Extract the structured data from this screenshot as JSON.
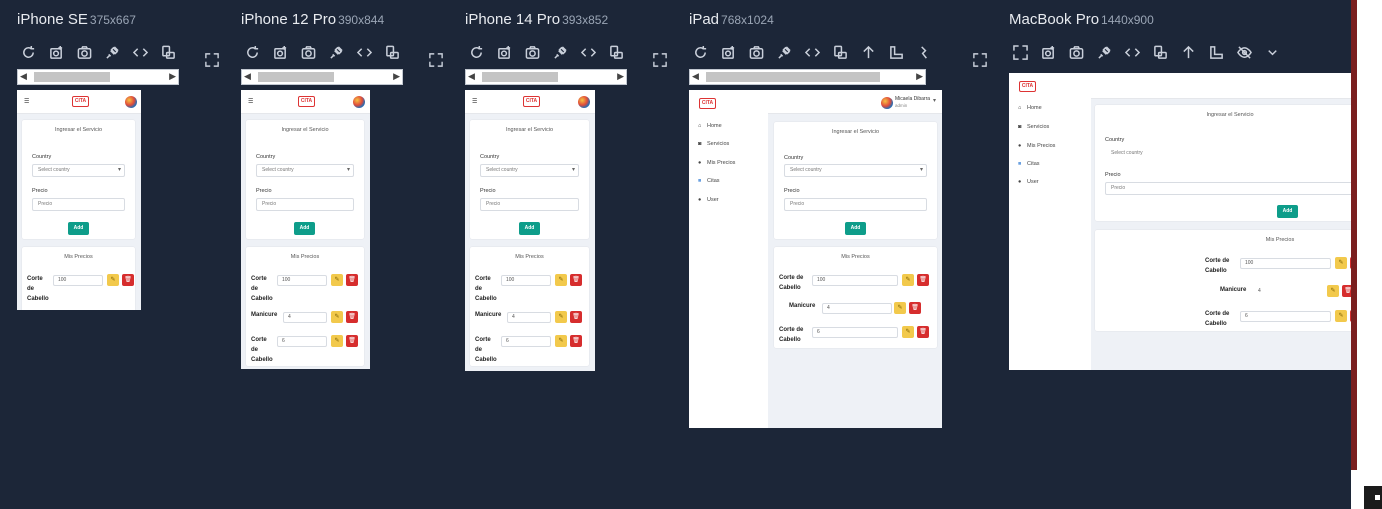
{
  "colors": {
    "background": "#1c2638",
    "accent": "#0e9d8a",
    "edit": "#f2c94c",
    "delete": "#d62d2d",
    "logo": "#d33333"
  },
  "toolbar_icons": [
    "refresh-icon",
    "screenshot-icon",
    "camera-icon",
    "plug-icon",
    "code-icon",
    "rotate-device-icon",
    "arrow-up-icon",
    "ruler-icon",
    "eye-off-icon",
    "chevron-down-icon"
  ],
  "app": {
    "logo": "CITA",
    "form_title": "Ingresar el Servicio",
    "country_label": "Country",
    "country_placeholder": "Select country",
    "price_label": "Precio",
    "price_placeholder": "Precio",
    "add_label": "Add",
    "list_title": "Mis Precios",
    "user_name": "Micaela Dibarra",
    "user_role": "admin",
    "sidebar_items": [
      "Home",
      "Servicios",
      "Mis Precios",
      "Citas",
      "User"
    ],
    "prices": [
      {
        "name": "Corte de Cabello",
        "value": "100"
      },
      {
        "name": "Manicure",
        "value": "4"
      },
      {
        "name": "Corte de Cabello",
        "value": "6"
      }
    ]
  },
  "devices": [
    {
      "name": "iPhone SE",
      "size": "375x667"
    },
    {
      "name": "iPhone 12 Pro",
      "size": "390x844"
    },
    {
      "name": "iPhone 14 Pro",
      "size": "393x852"
    },
    {
      "name": "iPad",
      "size": "768x1024"
    },
    {
      "name": "MacBook Pro",
      "size": "1440x900"
    }
  ]
}
